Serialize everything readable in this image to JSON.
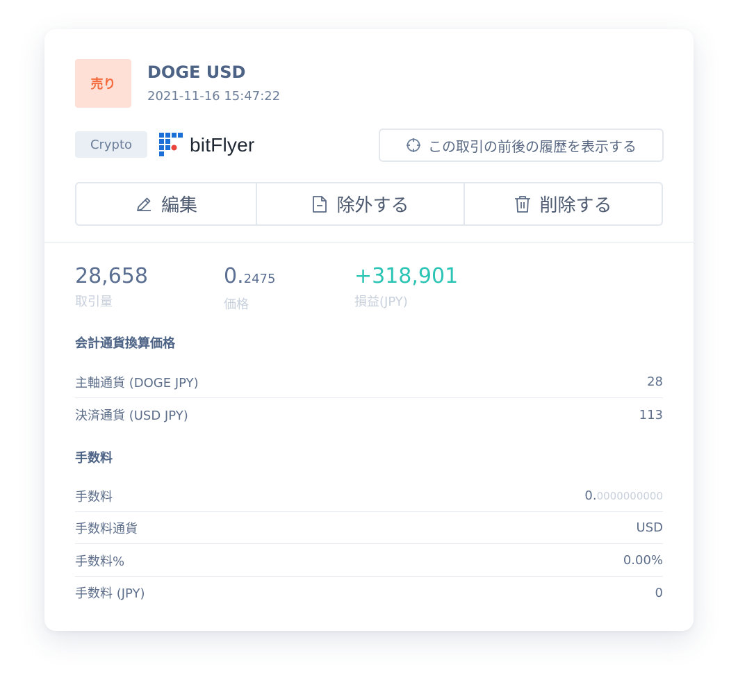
{
  "trade": {
    "side": "売り",
    "pair": "DOGE USD",
    "datetime": "2021-11-16 15:47:22",
    "category": "Crypto",
    "exchange": "bitFlyer",
    "history_label": "この取引の前後の履歴を表示する"
  },
  "actions": {
    "edit": "編集",
    "exclude": "除外する",
    "delete": "削除する"
  },
  "stats": {
    "volume_value": "28,658",
    "volume_label": "取引量",
    "price_value_main": "0.",
    "price_value_fraction": "2475",
    "price_label": "価格",
    "pnl_value": "+318,901",
    "pnl_label": "損益(JPY)"
  },
  "conversion": {
    "title": "会計通貨換算価格",
    "rows": [
      {
        "label": "主軸通貨 (DOGE JPY)",
        "value": "28"
      },
      {
        "label": "決済通貨 (USD JPY)",
        "value": "113"
      }
    ]
  },
  "fees": {
    "title": "手数料",
    "fee_label": "手数料",
    "fee_value_main": "0.",
    "fee_value_fraction": "0000000000",
    "rows": [
      {
        "label": "手数料通貨",
        "value": "USD"
      },
      {
        "label": "手数料%",
        "value": "0.00%"
      },
      {
        "label": "手数料 (JPY)",
        "value": "0"
      }
    ]
  },
  "colors": {
    "sell_badge_bg": "#ffe0d6",
    "sell_badge_text": "#f26a3d",
    "positive": "#2bc4b5",
    "exchange_logo_blue": "#1d6fd8",
    "exchange_logo_red": "#e8453c"
  }
}
